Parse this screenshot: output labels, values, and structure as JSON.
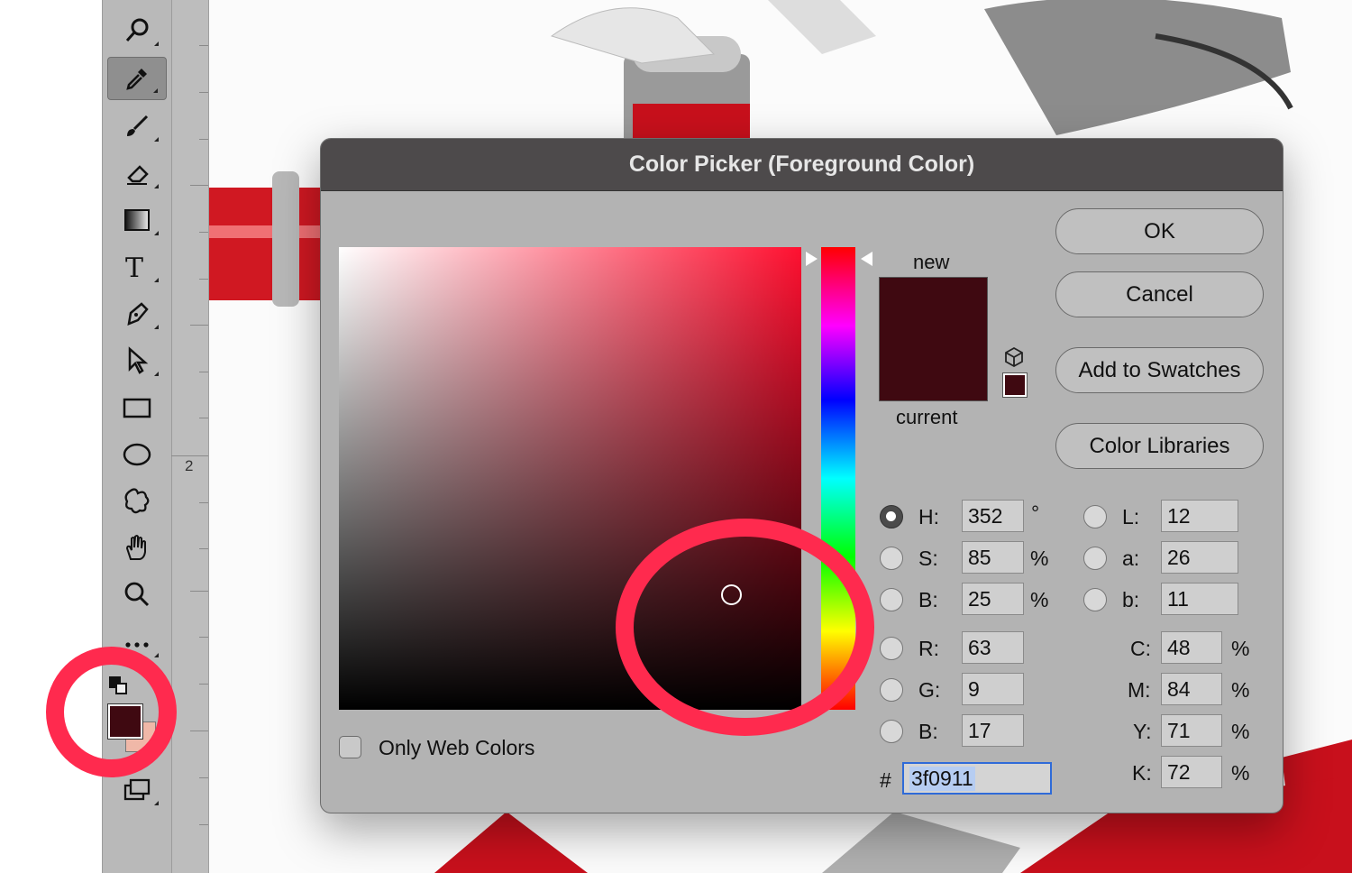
{
  "dialog": {
    "title": "Color Picker (Foreground Color)",
    "buttons": {
      "ok": "OK",
      "cancel": "Cancel",
      "add_to_swatches": "Add to Swatches",
      "color_libraries": "Color Libraries"
    },
    "preview": {
      "new_label": "new",
      "current_label": "current",
      "new_color": "#3f0911",
      "current_color": "#3f0911"
    },
    "only_web_colors": {
      "label": "Only Web Colors",
      "checked": false
    },
    "fields": {
      "hsb": [
        {
          "label": "H:",
          "value": "352",
          "unit": "°",
          "selected": true
        },
        {
          "label": "S:",
          "value": "85",
          "unit": "%",
          "selected": false
        },
        {
          "label": "B:",
          "value": "25",
          "unit": "%",
          "selected": false
        }
      ],
      "rgb": [
        {
          "label": "R:",
          "value": "63",
          "selected": false
        },
        {
          "label": "G:",
          "value": "9",
          "selected": false
        },
        {
          "label": "B:",
          "value": "17",
          "selected": false
        }
      ],
      "lab": [
        {
          "label": "L:",
          "value": "12",
          "selected": false
        },
        {
          "label": "a:",
          "value": "26",
          "selected": false
        },
        {
          "label": "b:",
          "value": "11",
          "selected": false
        }
      ],
      "cmyk": [
        {
          "label": "C:",
          "value": "48",
          "unit": "%"
        },
        {
          "label": "M:",
          "value": "84",
          "unit": "%"
        },
        {
          "label": "Y:",
          "value": "71",
          "unit": "%"
        },
        {
          "label": "K:",
          "value": "72",
          "unit": "%"
        }
      ],
      "hex": {
        "label": "#",
        "value": "3f0911"
      }
    }
  },
  "ruler": {
    "mark": "2"
  },
  "toolbar": {
    "tools": [
      "quick-selection",
      "eyedropper",
      "brush",
      "eraser",
      "gradient",
      "type",
      "pen",
      "path-selection",
      "rectangle",
      "ellipse",
      "custom-shape",
      "hand",
      "zoom",
      "more"
    ],
    "active_tool": "eyedropper",
    "foreground_color": "#3f0911",
    "background_color": "#f0b8a8"
  },
  "colors": {
    "highlight": "#ff2a4e",
    "dialog_title_bg": "#4d4a4b"
  }
}
